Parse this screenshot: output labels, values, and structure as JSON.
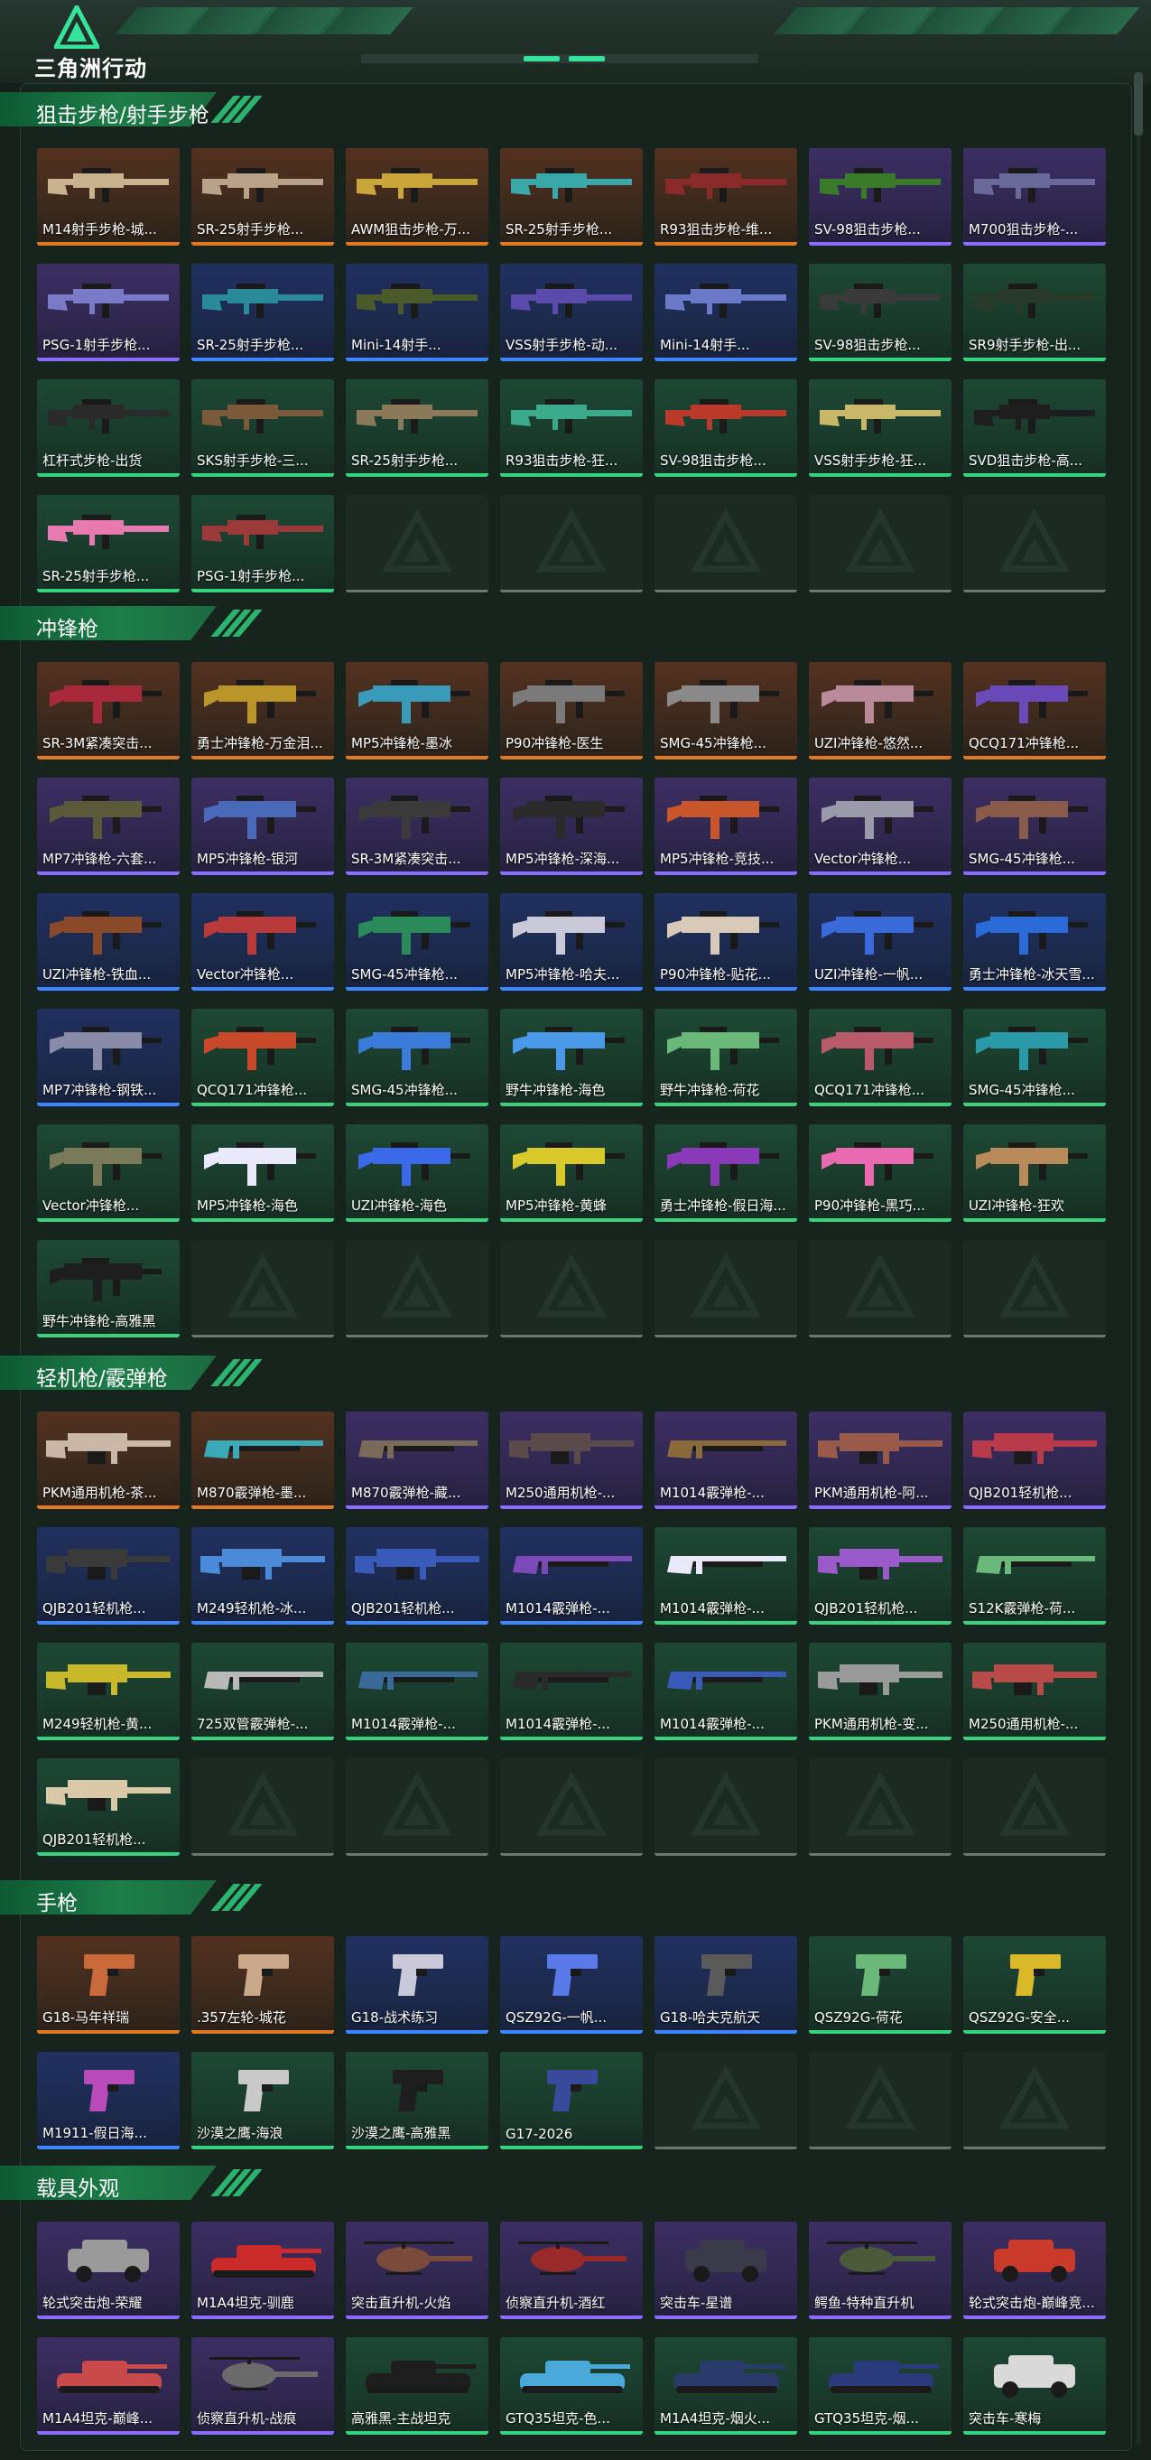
{
  "header": {
    "logo_text": "三角洲行动"
  },
  "sections": [
    {
      "title": "狙击步枪/射手步枪",
      "items": [
        {
          "label": "M14射手步枪-城...",
          "rarity": "orange",
          "type": "rifle",
          "color": "#c9b38f"
        },
        {
          "label": "SR-25射手步枪...",
          "rarity": "orange",
          "type": "rifle",
          "color": "#b9a28a"
        },
        {
          "label": "AWM狙击步枪-万...",
          "rarity": "orange",
          "type": "rifle",
          "color": "#c9a53a"
        },
        {
          "label": "SR-25射手步枪...",
          "rarity": "orange",
          "type": "rifle",
          "color": "#3aa8a8"
        },
        {
          "label": "R93狙击步枪-维...",
          "rarity": "orange",
          "type": "rifle",
          "color": "#8a2a2a"
        },
        {
          "label": "SV-98狙击步枪...",
          "rarity": "purple",
          "type": "rifle",
          "color": "#3a7a2a"
        },
        {
          "label": "M700狙击步枪-...",
          "rarity": "purple",
          "type": "rifle",
          "color": "#6a6a9a"
        },
        {
          "label": "PSG-1射手步枪...",
          "rarity": "purple",
          "type": "rifle",
          "color": "#7a7ac9"
        },
        {
          "label": "SR-25射手步枪...",
          "rarity": "blue",
          "type": "rifle",
          "color": "#2a8a9a"
        },
        {
          "label": "Mini-14射手...",
          "rarity": "blue",
          "type": "rifle",
          "color": "#4a5a2a"
        },
        {
          "label": "VSS射手步枪-动...",
          "rarity": "blue",
          "type": "rifle",
          "color": "#5a4aa9"
        },
        {
          "label": "Mini-14射手...",
          "rarity": "blue",
          "type": "rifle",
          "color": "#6a7ac9"
        },
        {
          "label": "SV-98狙击步枪...",
          "rarity": "green",
          "type": "rifle",
          "color": "#3a3a3a"
        },
        {
          "label": "SR9射手步枪-出...",
          "rarity": "green",
          "type": "rifle",
          "color": "#2a3a2a"
        },
        {
          "label": "杠杆式步枪-出货",
          "rarity": "green",
          "type": "rifle",
          "color": "#2a2a2a"
        },
        {
          "label": "SKS射手步枪-三...",
          "rarity": "green",
          "type": "rifle",
          "color": "#7a5a3a"
        },
        {
          "label": "SR-25射手步枪...",
          "rarity": "green",
          "type": "rifle",
          "color": "#8a7a5a"
        },
        {
          "label": "R93狙击步枪-狂...",
          "rarity": "green",
          "type": "rifle",
          "color": "#3aaa8a"
        },
        {
          "label": "SV-98狙击步枪...",
          "rarity": "green",
          "type": "rifle",
          "color": "#b93a2a"
        },
        {
          "label": "VSS射手步枪-狂...",
          "rarity": "green",
          "type": "rifle",
          "color": "#c9b86a"
        },
        {
          "label": "SVD狙击步枪-高...",
          "rarity": "green",
          "type": "rifle",
          "color": "#1e1e1e"
        },
        {
          "label": "SR-25射手步枪...",
          "rarity": "green",
          "type": "rifle",
          "color": "#e87ab0"
        },
        {
          "label": "PSG-1射手步枪...",
          "rarity": "green",
          "type": "rifle",
          "color": "#9a3a3a"
        }
      ]
    },
    {
      "title": "冲锋枪",
      "items": [
        {
          "label": "SR-3M紧凑突击...",
          "rarity": "orange",
          "type": "smg",
          "color": "#a82a3a"
        },
        {
          "label": "勇士冲锋枪-万金泪...",
          "rarity": "orange",
          "type": "smg",
          "color": "#b9952a"
        },
        {
          "label": "MP5冲锋枪-墨冰",
          "rarity": "orange",
          "type": "smg",
          "color": "#3a9ab9"
        },
        {
          "label": "P90冲锋枪-医生",
          "rarity": "orange",
          "type": "smg",
          "color": "#7a7a7a"
        },
        {
          "label": "SMG-45冲锋枪...",
          "rarity": "orange",
          "type": "smg",
          "color": "#8a8a8a"
        },
        {
          "label": "UZI冲锋枪-悠然...",
          "rarity": "orange",
          "type": "smg",
          "color": "#b98a9a"
        },
        {
          "label": "QCQ171冲锋枪...",
          "rarity": "orange",
          "type": "smg",
          "color": "#6a4ab9"
        },
        {
          "label": "MP7冲锋枪-六套...",
          "rarity": "purple",
          "type": "smg",
          "color": "#5a5a3a"
        },
        {
          "label": "MP5冲锋枪-银河",
          "rarity": "purple",
          "type": "smg",
          "color": "#4a6ab9"
        },
        {
          "label": "SR-3M紧凑突击...",
          "rarity": "purple",
          "type": "smg",
          "color": "#3a3a3a"
        },
        {
          "label": "MP5冲锋枪-深海...",
          "rarity": "purple",
          "type": "smg",
          "color": "#2a2a2a"
        },
        {
          "label": "MP5冲锋枪-竞技...",
          "rarity": "purple",
          "type": "smg",
          "color": "#c9552a"
        },
        {
          "label": "Vector冲锋枪...",
          "rarity": "purple",
          "type": "smg",
          "color": "#9a9aaa"
        },
        {
          "label": "SMG-45冲锋枪...",
          "rarity": "purple",
          "type": "smg",
          "color": "#8a5a4a"
        },
        {
          "label": "UZI冲锋枪-铁血...",
          "rarity": "blue",
          "type": "smg",
          "color": "#8a4a2a"
        },
        {
          "label": "Vector冲锋枪...",
          "rarity": "blue",
          "type": "smg",
          "color": "#b93a3a"
        },
        {
          "label": "SMG-45冲锋枪...",
          "rarity": "blue",
          "type": "smg",
          "color": "#2a8a5a"
        },
        {
          "label": "MP5冲锋枪-哈夫...",
          "rarity": "blue",
          "type": "smg",
          "color": "#c9c9d9"
        },
        {
          "label": "P90冲锋枪-贴花...",
          "rarity": "blue",
          "type": "smg",
          "color": "#d9c9b9"
        },
        {
          "label": "UZI冲锋枪-一帆...",
          "rarity": "blue",
          "type": "smg",
          "color": "#3a6ad9"
        },
        {
          "label": "勇士冲锋枪-冰天雪...",
          "rarity": "blue",
          "type": "smg",
          "color": "#2a6ad9"
        },
        {
          "label": "MP7冲锋枪-钢铁...",
          "rarity": "blue",
          "type": "smg",
          "color": "#8a8aa9"
        },
        {
          "label": "QCQ171冲锋枪...",
          "rarity": "green",
          "type": "smg",
          "color": "#c94a2a"
        },
        {
          "label": "SMG-45冲锋枪...",
          "rarity": "green",
          "type": "smg",
          "color": "#3a7ad9"
        },
        {
          "label": "野牛冲锋枪-海色",
          "rarity": "green",
          "type": "smg",
          "color": "#4a9ae9"
        },
        {
          "label": "野牛冲锋枪-荷花",
          "rarity": "green",
          "type": "smg",
          "color": "#6ab97a"
        },
        {
          "label": "QCQ171冲锋枪...",
          "rarity": "green",
          "type": "smg",
          "color": "#b95a6a"
        },
        {
          "label": "SMG-45冲锋枪...",
          "rarity": "green",
          "type": "smg",
          "color": "#2a9aa9"
        },
        {
          "label": "Vector冲锋枪...",
          "rarity": "green",
          "type": "smg",
          "color": "#7a7a5a"
        },
        {
          "label": "MP5冲锋枪-海色",
          "rarity": "green",
          "type": "smg",
          "color": "#e9e9f9"
        },
        {
          "label": "UZI冲锋枪-海色",
          "rarity": "green",
          "type": "smg",
          "color": "#3a6ae9"
        },
        {
          "label": "MP5冲锋枪-黄蜂",
          "rarity": "green",
          "type": "smg",
          "color": "#d9c92a"
        },
        {
          "label": "勇士冲锋枪-假日海...",
          "rarity": "green",
          "type": "smg",
          "color": "#8a3ab9"
        },
        {
          "label": "P90冲锋枪-黑巧...",
          "rarity": "green",
          "type": "smg",
          "color": "#e96ab0"
        },
        {
          "label": "UZI冲锋枪-狂欢",
          "rarity": "green",
          "type": "smg",
          "color": "#b98a5a"
        },
        {
          "label": "野牛冲锋枪-高雅黑",
          "rarity": "green",
          "type": "smg",
          "color": "#1e1e1e"
        }
      ]
    },
    {
      "title": "轻机枪/霰弹枪",
      "items": [
        {
          "label": "PKM通用机枪-茶...",
          "rarity": "orange",
          "type": "mg",
          "color": "#c9b8a8"
        },
        {
          "label": "M870霰弹枪-墨...",
          "rarity": "orange",
          "type": "shotgun",
          "color": "#3aaab9"
        },
        {
          "label": "M870霰弹枪-藏...",
          "rarity": "purple",
          "type": "shotgun",
          "color": "#7a6a5a"
        },
        {
          "label": "M250通用机枪-...",
          "rarity": "purple",
          "type": "mg",
          "color": "#5a4a4a"
        },
        {
          "label": "M1014霰弹枪-...",
          "rarity": "purple",
          "type": "shotgun",
          "color": "#8a6a3a"
        },
        {
          "label": "PKM通用机枪-阿...",
          "rarity": "purple",
          "type": "mg",
          "color": "#9a5a4a"
        },
        {
          "label": "QJB201轻机枪...",
          "rarity": "purple",
          "type": "mg",
          "color": "#b93a4a"
        },
        {
          "label": "QJB201轻机枪...",
          "rarity": "blue",
          "type": "mg",
          "color": "#3a3a3a"
        },
        {
          "label": "M249轻机枪-冰...",
          "rarity": "blue",
          "type": "mg",
          "color": "#4a8ad9"
        },
        {
          "label": "QJB201轻机枪...",
          "rarity": "blue",
          "type": "mg",
          "color": "#3a5ab9"
        },
        {
          "label": "M1014霰弹枪-...",
          "rarity": "blue",
          "type": "shotgun",
          "color": "#7a4ab9"
        },
        {
          "label": "M1014霰弹枪-...",
          "rarity": "green",
          "type": "shotgun",
          "color": "#e9e9f9"
        },
        {
          "label": "QJB201轻机枪...",
          "rarity": "green",
          "type": "mg",
          "color": "#9a5ac9"
        },
        {
          "label": "S12K霰弹枪-荷...",
          "rarity": "green",
          "type": "shotgun",
          "color": "#6ab97a"
        },
        {
          "label": "M249轻机枪-黄...",
          "rarity": "green",
          "type": "mg",
          "color": "#c9b92a"
        },
        {
          "label": "725双管霰弹枪-...",
          "rarity": "green",
          "type": "shotgun",
          "color": "#b9b9b9"
        },
        {
          "label": "M1014霰弹枪-...",
          "rarity": "green",
          "type": "shotgun",
          "color": "#3a6a9a"
        },
        {
          "label": "M1014霰弹枪-...",
          "rarity": "green",
          "type": "shotgun",
          "color": "#2a2a2a"
        },
        {
          "label": "M1014霰弹枪-...",
          "rarity": "green",
          "type": "shotgun",
          "color": "#3a5ab9"
        },
        {
          "label": "PKM通用机枪-变...",
          "rarity": "green",
          "type": "mg",
          "color": "#9a9a9a"
        },
        {
          "label": "M250通用机枪-...",
          "rarity": "green",
          "type": "mg",
          "color": "#b94a4a"
        },
        {
          "label": "QJB201轻机枪...",
          "rarity": "green",
          "type": "mg",
          "color": "#d9c9a9"
        }
      ]
    },
    {
      "title": "手枪",
      "items": [
        {
          "label": "G18-马年祥瑞",
          "rarity": "orange",
          "type": "pistol",
          "color": "#c96a3a"
        },
        {
          "label": ".357左轮-城花",
          "rarity": "orange",
          "type": "pistol",
          "color": "#c9a98a"
        },
        {
          "label": "G18-战术练习",
          "rarity": "blue",
          "type": "pistol",
          "color": "#c9c9d9"
        },
        {
          "label": "QSZ92G-一帆...",
          "rarity": "blue",
          "type": "pistol",
          "color": "#5a7ae9"
        },
        {
          "label": "G18-哈夫克航天",
          "rarity": "blue",
          "type": "pistol",
          "color": "#5a5a5a"
        },
        {
          "label": "QSZ92G-荷花",
          "rarity": "green",
          "type": "pistol",
          "color": "#6ab97a"
        },
        {
          "label": "QSZ92G-安全...",
          "rarity": "green",
          "type": "pistol",
          "color": "#d9b92a"
        },
        {
          "label": "M1911-假日海...",
          "rarity": "blue",
          "type": "pistol",
          "color": "#b94ab9"
        },
        {
          "label": "沙漠之鹰-海浪",
          "rarity": "green",
          "type": "pistol",
          "color": "#c9c9c9"
        },
        {
          "label": "沙漠之鹰-高雅黑",
          "rarity": "green",
          "type": "pistol",
          "color": "#1e1e1e"
        },
        {
          "label": "G17-2026",
          "rarity": "green",
          "type": "pistol",
          "color": "#3a4a9a"
        }
      ]
    },
    {
      "title": "载具外观",
      "items": [
        {
          "label": "轮式突击炮-荣耀",
          "rarity": "purple",
          "type": "car",
          "color": "#9a9a9a"
        },
        {
          "label": "M1A4坦克-驯鹿",
          "rarity": "purple",
          "type": "tank",
          "color": "#c92a2a"
        },
        {
          "label": "突击直升机-火焰",
          "rarity": "purple",
          "type": "heli",
          "color": "#7a4a3a"
        },
        {
          "label": "侦察直升机-酒红",
          "rarity": "purple",
          "type": "heli",
          "color": "#9a2a2a"
        },
        {
          "label": "突击车-星谱",
          "rarity": "purple",
          "type": "car",
          "color": "#3a3a4a"
        },
        {
          "label": "鳄鱼-特种直升机",
          "rarity": "purple",
          "type": "heli",
          "color": "#4a5a3a"
        },
        {
          "label": "轮式突击炮-巅峰竞...",
          "rarity": "purple",
          "type": "car",
          "color": "#c93a2a"
        },
        {
          "label": "M1A4坦克-巅峰...",
          "rarity": "purple",
          "type": "tank",
          "color": "#c94a4a"
        },
        {
          "label": "侦察直升机-战痕",
          "rarity": "purple",
          "type": "heli",
          "color": "#6a6a6a"
        },
        {
          "label": "高雅黑-主战坦克",
          "rarity": "green",
          "type": "tank",
          "color": "#1e1e1e"
        },
        {
          "label": "GTQ35坦克-色...",
          "rarity": "green",
          "type": "tank",
          "color": "#4aa9d9"
        },
        {
          "label": "M1A4坦克-烟火...",
          "rarity": "green",
          "type": "tank",
          "color": "#2a3a6a"
        },
        {
          "label": "GTQ35坦克-烟...",
          "rarity": "green",
          "type": "tank",
          "color": "#2a3a7a"
        },
        {
          "label": "突击车-寒梅",
          "rarity": "green",
          "type": "car",
          "color": "#d9d9d9"
        }
      ]
    }
  ]
}
